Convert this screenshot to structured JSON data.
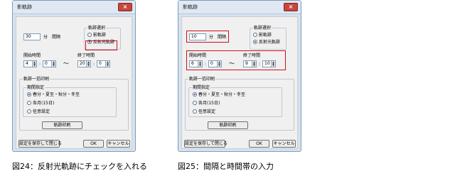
{
  "figures": [
    {
      "window_title": "影軌跡",
      "close_glyph": "×",
      "interval_value": "30",
      "interval_unit": "分",
      "interval_label": "間隔",
      "track_select_title": "軌跡選択",
      "track_option1": "影軌跡",
      "track_option2": "反射光軌跡",
      "start_time_label": "開始時間",
      "end_time_label": "終了時間",
      "start_hour": "4",
      "start_min": "0",
      "tilde": "〜",
      "end_hour": "20",
      "end_min": "0",
      "print_group_title": "軌跡一括印刷",
      "period_title": "期間指定",
      "period_option1": "春分・夏至・秋分・冬至",
      "period_option2": "各月(15日)",
      "period_option3": "任意設定",
      "print_button": "軌跡印刷",
      "save_close_button": "設定を保存して閉じる",
      "ok_button": "OK",
      "cancel_button": "キャンセル",
      "caption": "図24：反射光軌跡にチェックを入れる"
    },
    {
      "window_title": "影軌跡",
      "close_glyph": "×",
      "interval_value": "10",
      "interval_unit": "分",
      "interval_label": "間隔",
      "track_select_title": "軌跡選択",
      "track_option1": "影軌跡",
      "track_option2": "反射光軌跡",
      "start_time_label": "開始時間",
      "end_time_label": "終了時間",
      "start_hour": "6",
      "start_min": "0",
      "tilde": "〜",
      "end_hour": "9",
      "end_min": "10",
      "print_group_title": "軌跡一括印刷",
      "period_title": "期間指定",
      "period_option1": "春分・夏至・秋分・冬至",
      "period_option2": "各月(15日)",
      "period_option3": "任意設定",
      "print_button": "軌跡印刷",
      "save_close_button": "設定を保存して閉じる",
      "ok_button": "OK",
      "cancel_button": "キャンセル",
      "caption": "図25：間隔と時間帯の入力"
    }
  ],
  "colors": {
    "highlight": "#d0101a",
    "title_bar": "#dfe8f3",
    "close_button": "#c9463d"
  }
}
